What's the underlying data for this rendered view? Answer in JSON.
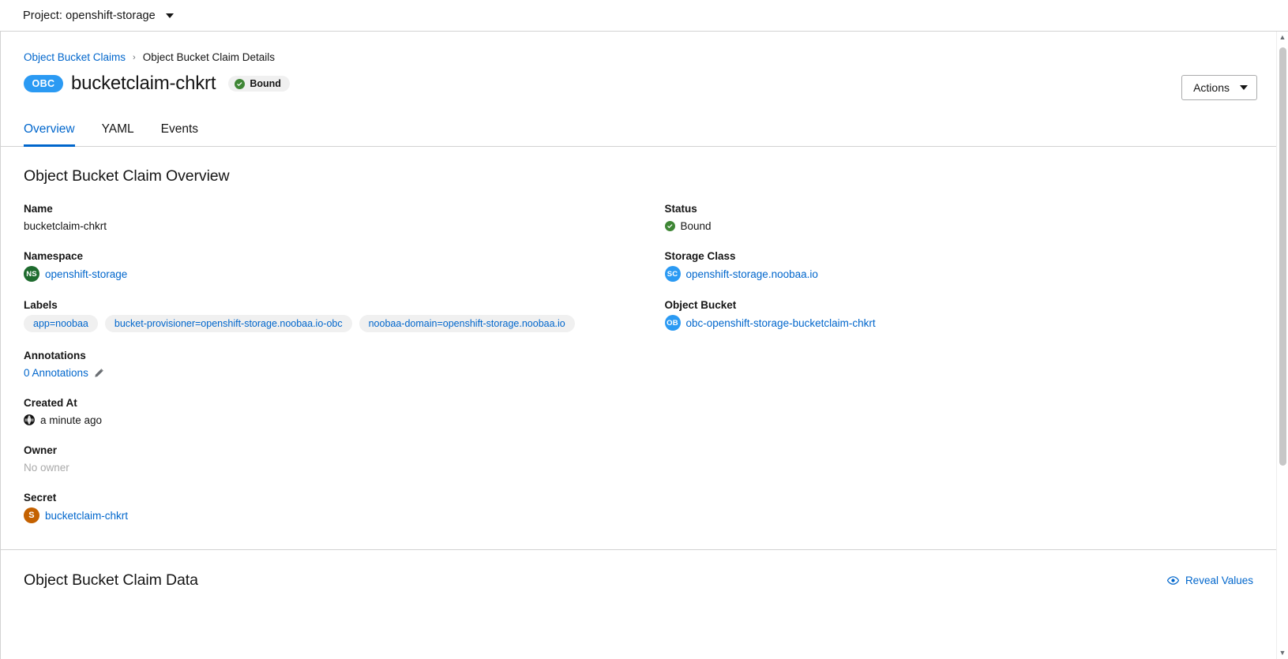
{
  "project_bar": {
    "label": "Project: openshift-storage",
    "caret_icon": "chevron-down-icon"
  },
  "breadcrumb": {
    "parent": "Object Bucket Claims",
    "separator": "›",
    "current": "Object Bucket Claim Details"
  },
  "header": {
    "resource_badge": "OBC",
    "title": "bucketclaim-chkrt",
    "status": "Bound",
    "status_icon": "check-circle-icon",
    "actions_label": "Actions",
    "actions_caret_icon": "chevron-down-icon"
  },
  "tabs": [
    {
      "label": "Overview",
      "active": true
    },
    {
      "label": "YAML",
      "active": false
    },
    {
      "label": "Events",
      "active": false
    }
  ],
  "overview": {
    "title": "Object Bucket Claim Overview",
    "left": {
      "name_label": "Name",
      "name_value": "bucketclaim-chkrt",
      "namespace_label": "Namespace",
      "namespace_badge": "NS",
      "namespace_value": "openshift-storage",
      "labels_label": "Labels",
      "labels": [
        "app=noobaa",
        "bucket-provisioner=openshift-storage.noobaa.io-obc",
        "noobaa-domain=openshift-storage.noobaa.io"
      ],
      "annotations_label": "Annotations",
      "annotations_value": "0 Annotations",
      "annotations_edit_icon": "pencil-icon",
      "created_at_label": "Created At",
      "created_at_icon": "globe-icon",
      "created_at_value": "a minute ago",
      "owner_label": "Owner",
      "owner_value": "No owner",
      "secret_label": "Secret",
      "secret_badge": "S",
      "secret_value": "bucketclaim-chkrt"
    },
    "right": {
      "status_label": "Status",
      "status_icon": "check-circle-icon",
      "status_value": "Bound",
      "storage_class_label": "Storage Class",
      "storage_class_badge": "SC",
      "storage_class_value": "openshift-storage.noobaa.io",
      "object_bucket_label": "Object Bucket",
      "object_bucket_badge": "OB",
      "object_bucket_value": "obc-openshift-storage-bucketclaim-chkrt"
    }
  },
  "data_section": {
    "title": "Object Bucket Claim Data",
    "reveal_label": "Reveal Values",
    "reveal_icon": "eye-icon"
  },
  "scrollbar": {
    "up_arrow_icon": "caret-up-icon",
    "down_arrow_icon": "caret-down-icon"
  },
  "colors": {
    "link": "#0066cc",
    "accent": "#2b9af3",
    "success": "#3e8635",
    "namespace": "#1e6b2e",
    "secret": "#c46100"
  }
}
